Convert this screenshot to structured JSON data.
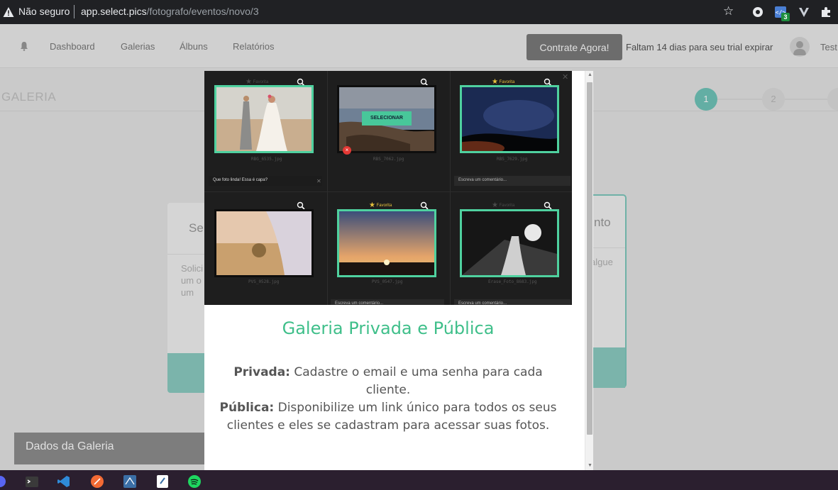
{
  "browser": {
    "security_label": "Não seguro",
    "url_host": "app.select.pics",
    "url_path": "/fotografo/eventos/novo/3",
    "extension_badge": "3"
  },
  "nav": {
    "dashboard": "Dashboard",
    "galerias": "Galerias",
    "albuns": "Álbuns",
    "relatorios": "Relatórios",
    "cta": "Contrate Agora!",
    "trial_text": "Faltam 14 dias para seu trial expirar",
    "user_name": "Test"
  },
  "page": {
    "title": "GALERIA",
    "steps": [
      "1",
      "2"
    ],
    "left_card_head": "Se",
    "left_card_body": [
      "Solici",
      "um o",
      "um"
    ],
    "right_card_head": "nto",
    "right_card_body": "algue",
    "dados_label": "Dados da Galeria"
  },
  "modal": {
    "preview": {
      "favorite_label": "Favorita",
      "select_label": "SELECIONAR",
      "filenames": [
        "RBG_6535.jpg",
        "RBS_7062.jpg",
        "RBS_7629.jpg",
        "PVS_0528.jpg",
        "PVS_0547.jpg",
        "Erase_Foto_8683.jpg"
      ],
      "comment_filled": "Que foto linda! Essa é capa?",
      "comment_placeholder": "Escreva um comentário..."
    },
    "title": "Galeria Privada e Pública",
    "private_label": "Privada:",
    "private_text": " Cadastre o email e uma senha para cada cliente.",
    "public_label": "Pública:",
    "public_text": " Disponibilize um link único para todos os seus clientes e eles se cadastram para acessar suas fotos."
  },
  "colors": {
    "accent": "#3fbf8a",
    "teal": "#71c7bb",
    "cta_bg": "#7b7b7b"
  }
}
